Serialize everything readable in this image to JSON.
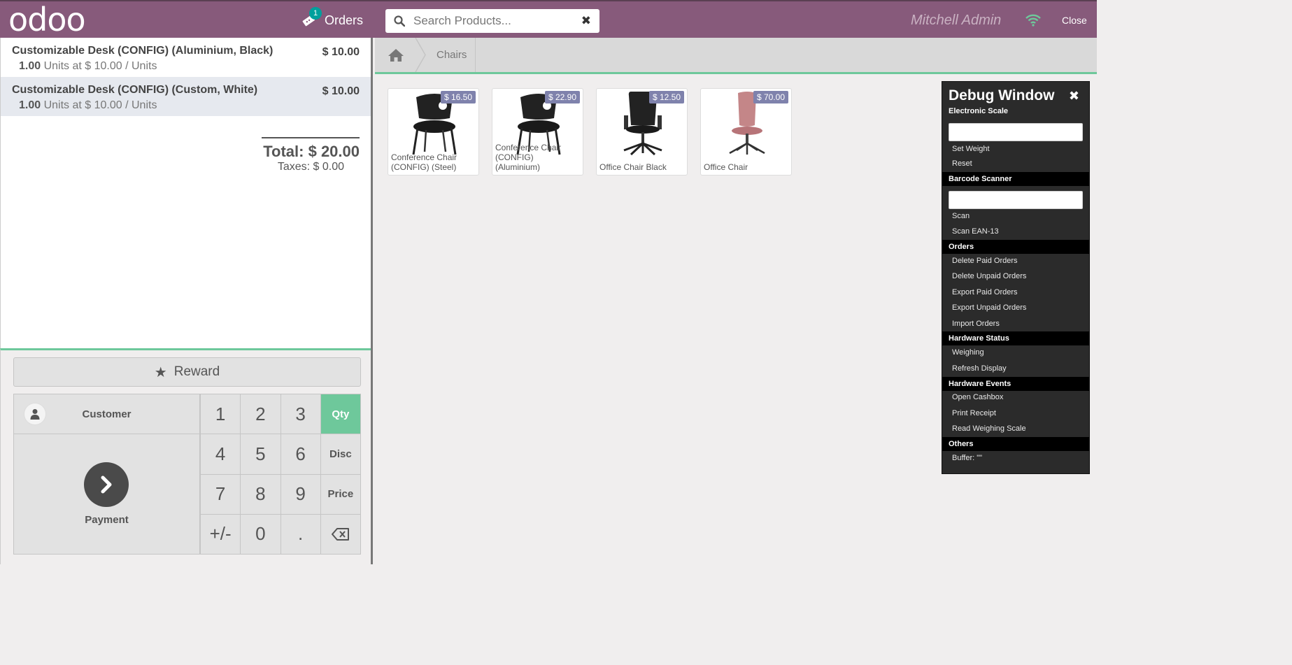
{
  "header": {
    "logo": "odoo",
    "orders_label": "Orders",
    "orders_badge": "1",
    "search_placeholder": "Search Products...",
    "user_name": "Mitchell Admin",
    "close_label": "Close"
  },
  "orderlines": [
    {
      "name": "Customizable Desk (CONFIG) (Aluminium, Black)",
      "price": "$ 10.00",
      "qty": "1.00",
      "info": "Units at $ 10.00 / Units"
    },
    {
      "name": "Customizable Desk (CONFIG) (Custom, White)",
      "price": "$ 10.00",
      "qty": "1.00",
      "info": "Units at $ 10.00 / Units"
    }
  ],
  "summary": {
    "total": "Total: $ 20.00",
    "taxes": "Taxes: $ 0.00"
  },
  "controls": {
    "reward_label": "Reward",
    "customer_label": "Customer",
    "payment_label": "Payment",
    "keys": [
      "1",
      "2",
      "3",
      "Qty",
      "4",
      "5",
      "6",
      "Disc",
      "7",
      "8",
      "9",
      "Price",
      "+/-",
      "0",
      "."
    ],
    "active_mode": "Qty"
  },
  "breadcrumb": {
    "category": "Chairs"
  },
  "products": [
    {
      "name": "Conference Chair (CONFIG) (Steel)",
      "price": "$ 16.50"
    },
    {
      "name": "Conference Chair (CONFIG) (Aluminium)",
      "price": "$ 22.90"
    },
    {
      "name": "Office Chair Black",
      "price": "$ 12.50"
    },
    {
      "name": "Office Chair",
      "price": "$ 70.00"
    }
  ],
  "debug": {
    "title": "Debug Window",
    "electronic_scale": "Electronic Scale",
    "set_weight": "Set Weight",
    "reset": "Reset",
    "barcode_scanner": "Barcode Scanner",
    "scan": "Scan",
    "scan_ean": "Scan EAN-13",
    "orders": "Orders",
    "delete_paid": "Delete Paid Orders",
    "delete_unpaid": "Delete Unpaid Orders",
    "export_paid": "Export Paid Orders",
    "export_unpaid": "Export Unpaid Orders",
    "import_orders": "Import Orders",
    "hardware_status": "Hardware Status",
    "weighing": "Weighing",
    "refresh_display": "Refresh Display",
    "hardware_events": "Hardware Events",
    "open_cashbox": "Open Cashbox",
    "print_receipt": "Print Receipt",
    "read_scale": "Read Weighing Scale",
    "others": "Others",
    "buffer": "Buffer: \"\""
  },
  "colors": {
    "brand": "#875a7b",
    "accent": "#6ec89b",
    "price_tag": "#7f82ac",
    "badge": "#00a09d"
  }
}
